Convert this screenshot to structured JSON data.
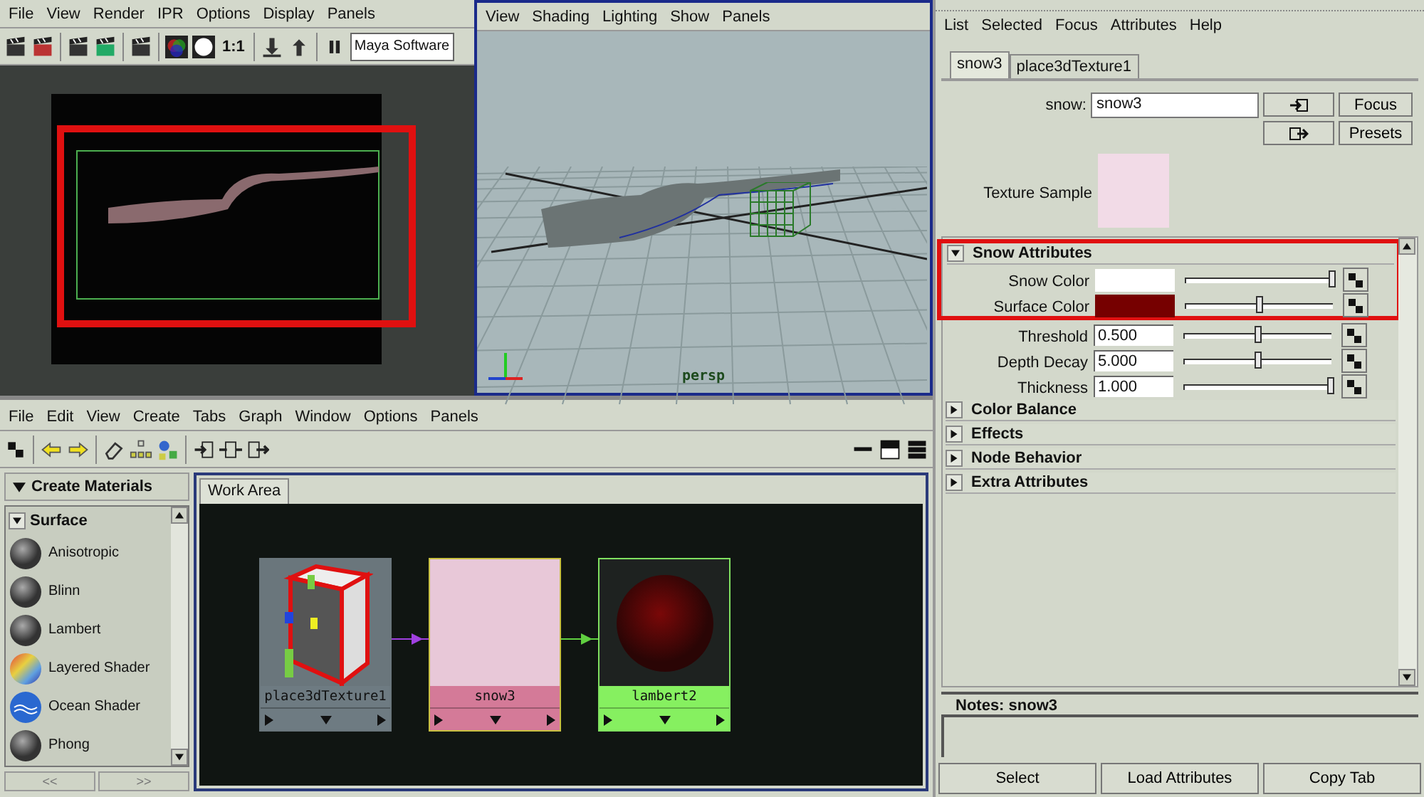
{
  "render_view": {
    "menu": [
      "File",
      "View",
      "Render",
      "IPR",
      "Options",
      "Display",
      "Panels"
    ],
    "ratio_label": "1:1",
    "renderer": "Maya Software",
    "highlighted": true
  },
  "viewport": {
    "menu": [
      "View",
      "Shading",
      "Lighting",
      "Show",
      "Panels"
    ],
    "camera": "persp"
  },
  "hypershade": {
    "menu": [
      "File",
      "Edit",
      "View",
      "Create",
      "Tabs",
      "Graph",
      "Window",
      "Options",
      "Panels"
    ],
    "create_panel": {
      "title": "Create Materials",
      "expanded": true,
      "category": {
        "label": "Surface",
        "expanded": true
      },
      "items": [
        {
          "label": "Anisotropic",
          "kind": "grey"
        },
        {
          "label": "Blinn",
          "kind": "grey"
        },
        {
          "label": "Lambert",
          "kind": "grey"
        },
        {
          "label": "Layered Shader",
          "kind": "layered"
        },
        {
          "label": "Ocean Shader",
          "kind": "ocean"
        },
        {
          "label": "Phong",
          "kind": "grey"
        }
      ],
      "nav_buttons": [
        "<<",
        ">>"
      ]
    },
    "work_area": {
      "tab": "Work Area",
      "nodes": [
        {
          "name": "place3dTexture1",
          "kind": "placement",
          "color": "#6e7b82"
        },
        {
          "name": "snow3",
          "kind": "texture",
          "color": "#d47a98"
        },
        {
          "name": "lambert2",
          "kind": "shader",
          "color": "#86f060"
        }
      ]
    }
  },
  "attribute_editor": {
    "menu": [
      "List",
      "Selected",
      "Focus",
      "Attributes",
      "Help"
    ],
    "tabs": [
      {
        "label": "snow3",
        "selected": true
      },
      {
        "label": "place3dTexture1",
        "selected": false
      }
    ],
    "node_label": "snow:",
    "node_name": "snow3",
    "buttons": [
      "Focus",
      "Presets"
    ],
    "sample_label": "Texture Sample",
    "sections": [
      {
        "title": "Snow Attributes",
        "expanded": true,
        "highlighted": true,
        "framed_rows": [
          {
            "label": "Snow Color",
            "kind": "color",
            "color": "#ffffff",
            "level": 1
          },
          {
            "label": "Surface Color",
            "kind": "color",
            "color": "#760000",
            "level": 0.5
          }
        ],
        "rows": [
          {
            "label": "Threshold",
            "kind": "number",
            "value": "0.500",
            "level": 0.5
          },
          {
            "label": "Depth Decay",
            "kind": "number",
            "value": "5.000",
            "level": 0.5
          },
          {
            "label": "Thickness",
            "kind": "number",
            "value": "1.000",
            "level": 1
          }
        ]
      },
      {
        "title": "Color Balance",
        "expanded": false,
        "highlighted": false
      },
      {
        "title": "Effects",
        "expanded": false,
        "highlighted": false
      },
      {
        "title": "Node Behavior",
        "expanded": false,
        "highlighted": false
      },
      {
        "title": "Extra Attributes",
        "expanded": false,
        "highlighted": false
      }
    ],
    "notes": "Notes:  snow3",
    "bottom_buttons": [
      "Select",
      "Load Attributes",
      "Copy Tab"
    ]
  }
}
